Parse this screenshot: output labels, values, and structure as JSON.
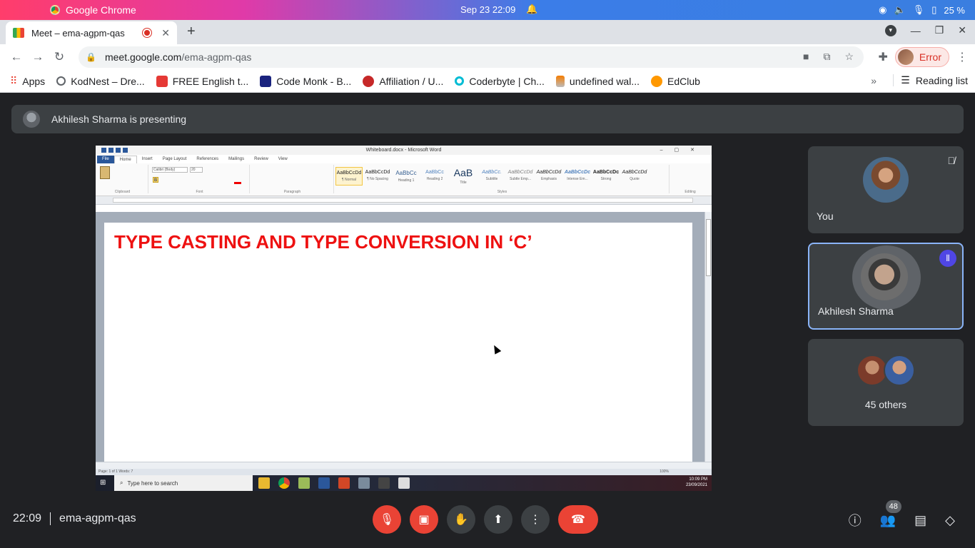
{
  "os": {
    "app_name": "Google Chrome",
    "clock": "Sep 23  22:09",
    "battery": "25 %"
  },
  "browser": {
    "tab_title": "Meet – ema-agpm-qas",
    "url_host": "meet.google.com",
    "url_path": "/ema-agpm-qas",
    "profile_label": "Error",
    "bookmarks": [
      {
        "label": "Apps",
        "color": "#ea4335"
      },
      {
        "label": "KodNest – Dre...",
        "color": "#5f6368"
      },
      {
        "label": "FREE English t...",
        "color": "#e53935"
      },
      {
        "label": "Code Monk - B...",
        "color": "#1a237e"
      },
      {
        "label": "Affiliation / U...",
        "color": "#c62828"
      },
      {
        "label": "Coderbyte | Ch...",
        "color": "#00bcd4"
      },
      {
        "label": "undefined wal...",
        "color": "#f57c00"
      },
      {
        "label": "EdClub",
        "color": "#ff9800"
      }
    ],
    "reading_list": "Reading list"
  },
  "meet": {
    "presenting_text": "Akhilesh Sharma is presenting",
    "time": "22:09",
    "meeting_code": "ema-agpm-qas",
    "participant_count": "48",
    "tiles": {
      "you": "You",
      "presenter": "Akhilesh Sharma",
      "others": "45 others"
    }
  },
  "shared_screen": {
    "window_title": "Whiteboard.docx - Microsoft Word",
    "ribbon_tabs": [
      "File",
      "Home",
      "Insert",
      "Page Layout",
      "References",
      "Mailings",
      "Review",
      "View"
    ],
    "styles": [
      {
        "sample": "AaBbCcDd",
        "name": "¶ Normal"
      },
      {
        "sample": "AaBbCcDd",
        "name": "¶ No Spacing"
      },
      {
        "sample": "AaBbCc",
        "name": "Heading 1"
      },
      {
        "sample": "AaBbCc",
        "name": "Heading 2"
      },
      {
        "sample": "AaB",
        "name": "Title"
      },
      {
        "sample": "AaBbCc.",
        "name": "Subtitle"
      },
      {
        "sample": "AaBbCcDd",
        "name": "Subtle Emp..."
      },
      {
        "sample": "AaBbCcDd",
        "name": "Emphasis"
      },
      {
        "sample": "AaBbCcDc",
        "name": "Intense Em..."
      },
      {
        "sample": "AaBbCcDc",
        "name": "Strong"
      },
      {
        "sample": "AaBbCcDd",
        "name": "Quote"
      }
    ],
    "group_labels": {
      "clipboard": "Clipboard",
      "font": "Font",
      "paragraph": "Paragraph",
      "styles": "Styles",
      "editing": "Editing"
    },
    "font_name": "Calibri (Body)",
    "font_size": "20",
    "heading_text": "TYPE CASTING AND TYPE CONVERSION IN ‘C’",
    "status_text": "Page: 1 of 1   Words: 7",
    "zoom": "100%",
    "taskbar_search": "Type here to search",
    "tray_time": "10:09 PM",
    "tray_date": "23/09/2021"
  }
}
